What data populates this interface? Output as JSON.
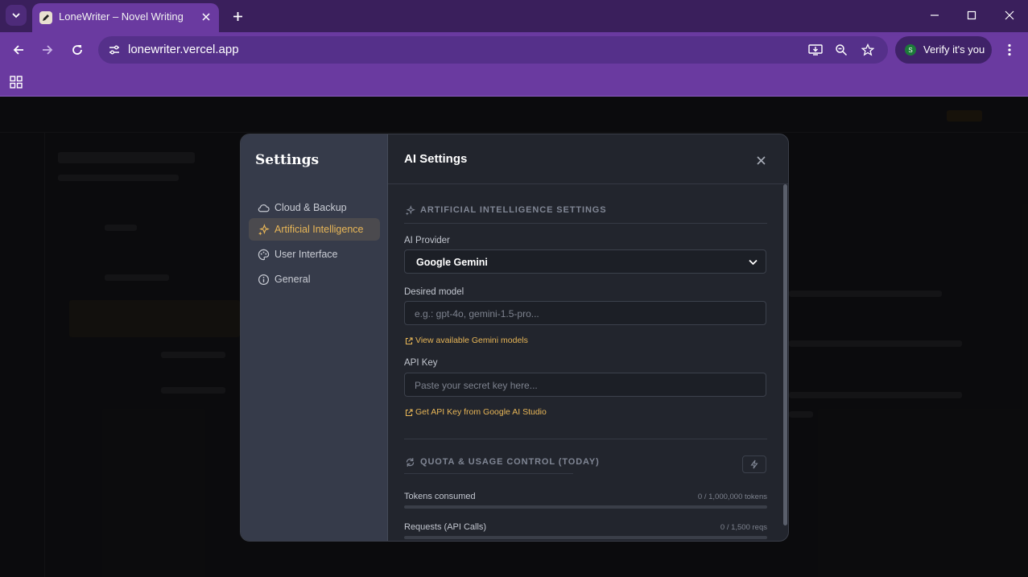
{
  "browser": {
    "tab_title": "LoneWriter – Novel Writing",
    "url": "lonewriter.vercel.app",
    "verify_label": "Verify it's you",
    "profile_initial": "S"
  },
  "settings": {
    "title": "Settings",
    "nav": [
      {
        "label": "Cloud & Backup",
        "icon": "cloud-icon",
        "active": false
      },
      {
        "label": "Artificial Intelligence",
        "icon": "sparkles-icon",
        "active": true
      },
      {
        "label": "User Interface",
        "icon": "palette-icon",
        "active": false
      },
      {
        "label": "General",
        "icon": "info-icon",
        "active": false
      }
    ]
  },
  "ai_settings": {
    "title": "AI Settings",
    "section_title": "ARTIFICIAL INTELLIGENCE SETTINGS",
    "provider_label": "AI Provider",
    "provider_value": "Google Gemini",
    "model_label": "Desired model",
    "model_placeholder": "e.g.: gpt-4o, gemini-1.5-pro...",
    "models_link": "View available Gemini models",
    "api_key_label": "API Key",
    "api_key_placeholder": "Paste your secret key here...",
    "api_key_link": "Get API Key from Google AI Studio"
  },
  "quota": {
    "section_title": "QUOTA & USAGE CONTROL (TODAY)",
    "tokens_label": "Tokens consumed",
    "tokens_count": "0 / 1,000,000 tokens",
    "tokens_fraction": 0,
    "requests_label": "Requests (API Calls)",
    "requests_count": "0 / 1,500 reqs",
    "requests_fraction": 0
  },
  "colors": {
    "accent": "#e8b657",
    "browser_frame": "#6a3aa0",
    "modal_bg": "#22252d",
    "sidebar_bg": "#363b4a"
  }
}
